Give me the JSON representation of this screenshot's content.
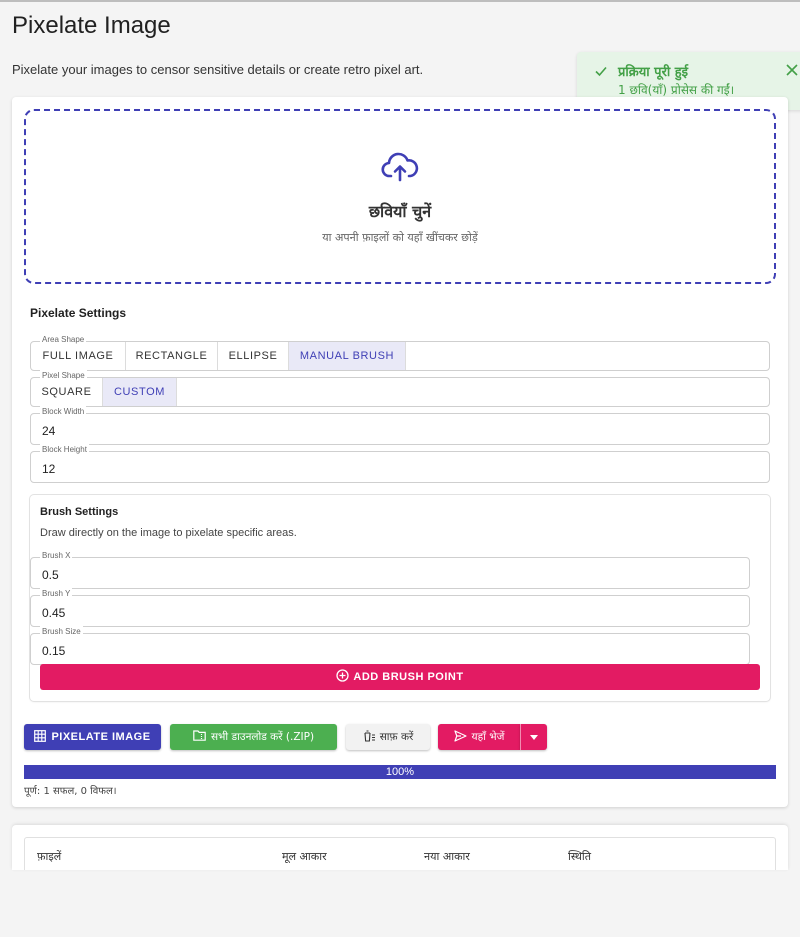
{
  "header": {
    "title": "Pixelate Image",
    "description": "Pixelate your images to censor sensitive details or create retro pixel art."
  },
  "toast": {
    "title": "प्रक्रिया पूरी हुई",
    "message": "1 छवि(याँ) प्रोसेस की गईं।",
    "icon": "check-icon",
    "close_icon": "close-icon",
    "color": "#43a047"
  },
  "dropzone": {
    "icon": "cloud-upload-icon",
    "title": "छवियाँ चुनें",
    "subtitle": "या अपनी फ़ाइलों को यहाँ खींचकर छोड़ें"
  },
  "settings": {
    "title": "Pixelate Settings",
    "area_shape": {
      "label": "Area Shape",
      "options": [
        "FULL IMAGE",
        "RECTANGLE",
        "ELLIPSE",
        "MANUAL BRUSH"
      ],
      "selected": "MANUAL BRUSH"
    },
    "pixel_shape": {
      "label": "Pixel Shape",
      "options": [
        "SQUARE",
        "CUSTOM"
      ],
      "selected": "CUSTOM"
    },
    "block_width": {
      "label": "Block Width",
      "value": "24"
    },
    "block_height": {
      "label": "Block Height",
      "value": "12"
    }
  },
  "brush": {
    "title": "Brush Settings",
    "description": "Draw directly on the image to pixelate specific areas.",
    "x": {
      "label": "Brush X",
      "value": "0.5"
    },
    "y": {
      "label": "Brush Y",
      "value": "0.45"
    },
    "size": {
      "label": "Brush Size",
      "value": "0.15"
    },
    "add_button": "ADD BRUSH POINT",
    "add_icon": "plus-circle-icon"
  },
  "actions": {
    "pixelate": "PIXELATE IMAGE",
    "download_all": "सभी डाउनलोड करें (.ZIP)",
    "clear": "साफ़ करें",
    "send_here": "यहाँ भेजें"
  },
  "progress": {
    "percent": 100,
    "label": "100%",
    "summary": "पूर्ण: 1 सफल, 0 विफल।"
  },
  "table": {
    "columns": [
      "फ़ाइलें",
      "मूल आकार",
      "नया आकार",
      "स्थिति"
    ]
  },
  "colors": {
    "primary": "#3f3fb5",
    "accent": "#e31b63",
    "success": "#4caf50"
  }
}
